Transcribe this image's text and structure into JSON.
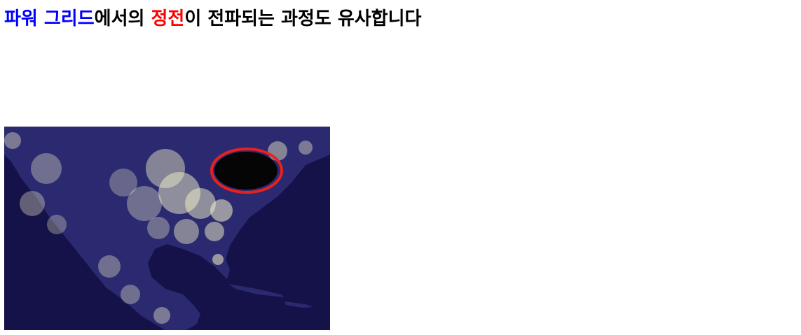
{
  "headline": {
    "segments": [
      {
        "text": "파워 그리드",
        "color": "#0000ff"
      },
      {
        "text": "에서의 ",
        "color": "#000000"
      },
      {
        "text": "정전",
        "color": "#ff0000"
      },
      {
        "text": "이 전파되는 과정도 유사합니다",
        "color": "#000000"
      }
    ]
  },
  "figure": {
    "subject": "night-lights-north-america",
    "highlight_icon": "red-ellipse-outage-marker",
    "colors": {
      "ocean": "#15124a",
      "land": "#2a2a6e",
      "lights": "#f4f1c8",
      "outage_area": "#050505",
      "marker": "#e82020"
    }
  }
}
